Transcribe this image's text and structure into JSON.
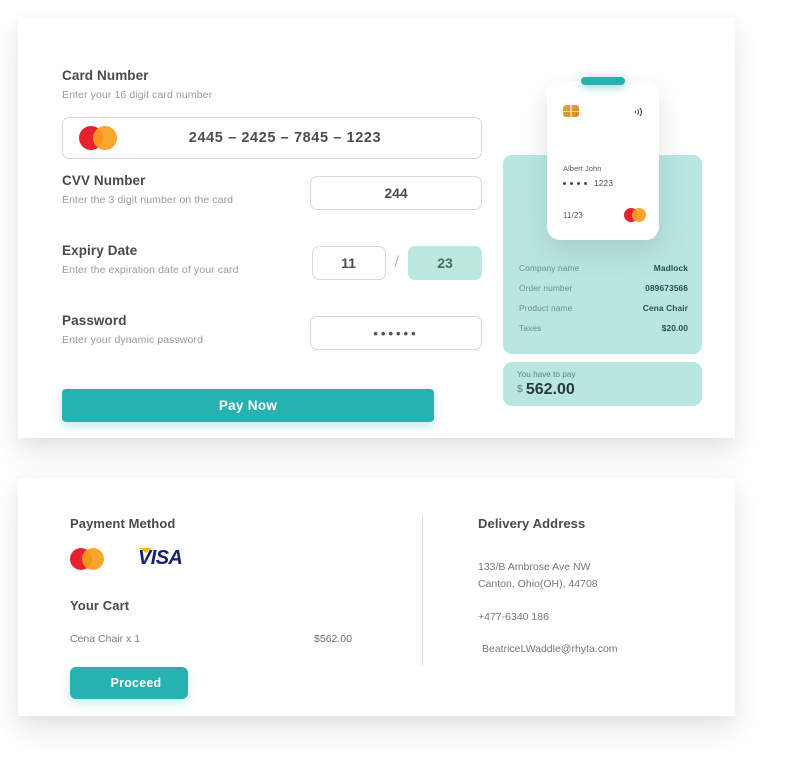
{
  "theme": {
    "accent_teal": "#27b2b2",
    "mint_panel": "#b8e6e0",
    "mastercard_red": "#e8212f",
    "mastercard_amber": "#f79e1b",
    "visa_blue": "#1a1f71",
    "visa_gold": "#f7b600",
    "chip_gold": "#d08e27"
  },
  "form": {
    "card_number": {
      "label": "Card Number",
      "hint": "Enter your 16 digit card number",
      "value": "2445  –  2425  –  7845  –  1223"
    },
    "cvv": {
      "label": "CVV Number",
      "hint": "Enter the 3 digit number on the card",
      "value": "244"
    },
    "expiry": {
      "label": "Expiry Date",
      "hint": "Enter the expiration date of your card",
      "month": "11",
      "separator": "/",
      "year": "23"
    },
    "password": {
      "label": "Password",
      "hint": "Enter your dynamic password",
      "value": "••••••"
    },
    "pay_button": "Pay Now"
  },
  "credit_card": {
    "holder_name": "Albert John",
    "masked_digits": "1223",
    "expiry": "11/23",
    "chip_icon": "emv-chip-icon",
    "contactless_icon": "contactless-icon",
    "brand_icon": "mastercard-icon"
  },
  "summary": {
    "rows": [
      {
        "key": "Company name",
        "value": "Madlock"
      },
      {
        "key": "Order number",
        "value": "089673566"
      },
      {
        "key": "Product name",
        "value": "Cena Chair"
      },
      {
        "key": "Taxes",
        "value": "$20.00"
      }
    ],
    "amount_label": "You have to pay",
    "currency": "$",
    "amount": "562.00"
  },
  "payment_method": {
    "title": "Payment Method",
    "logos": [
      "mastercard-icon",
      "visa-icon"
    ],
    "visa_text": "VISA"
  },
  "cart": {
    "title": "Your Cart",
    "item": "Cena Chair  x 1",
    "price": "$562.00",
    "proceed_button": "Proceed"
  },
  "delivery": {
    "title": "Delivery Address",
    "street": "133/B Ambrose Ave NW",
    "city": "Canton, Ohio(OH), 44708",
    "phone": "+477-6340 186",
    "email": "BeatriceLWaddle@rhyta.com"
  }
}
